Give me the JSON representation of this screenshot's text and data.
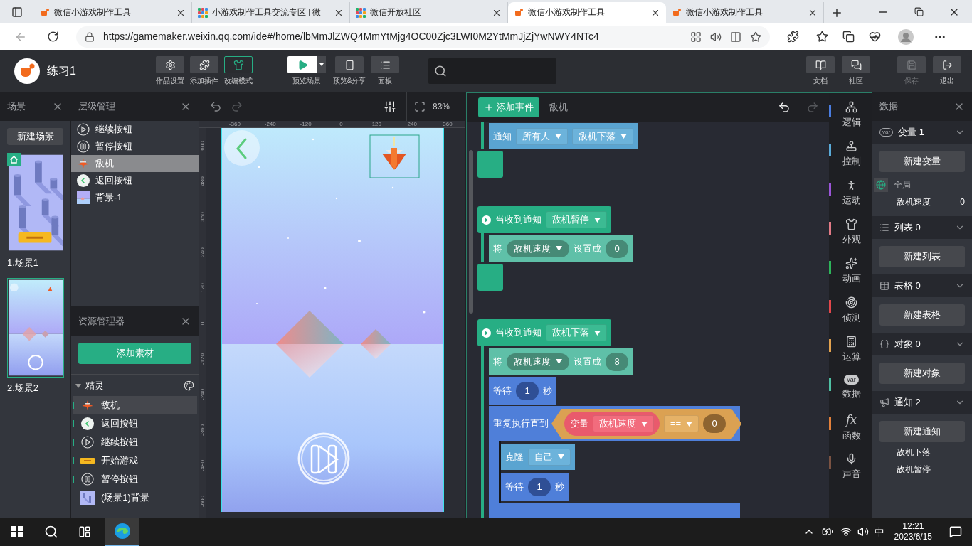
{
  "browser": {
    "tabs": [
      {
        "title": "微信小游戏制作工具",
        "kind": "app",
        "selected": false
      },
      {
        "title": "小游戏制作工具交流专区 | 微",
        "kind": "community",
        "selected": false
      },
      {
        "title": "微信开放社区",
        "kind": "community",
        "selected": false
      },
      {
        "title": "微信小游戏制作工具",
        "kind": "app",
        "selected": true
      },
      {
        "title": "微信小游戏制作工具",
        "kind": "app",
        "selected": false
      }
    ],
    "url": "https://gamemaker.weixin.qq.com/ide#/home/lbMmJlZWQ4MmYtMjg4OC00Zjc3LWI0M2YtMmJjZjYwNWY4NTc4"
  },
  "app_bar": {
    "project": "练习1",
    "tools": [
      {
        "label": "作品设置",
        "kind": "settings",
        "selected": false
      },
      {
        "label": "添加插件",
        "kind": "plugin",
        "selected": false
      },
      {
        "label": "改编模式",
        "kind": "shirt",
        "selected": true
      }
    ],
    "preview": {
      "label": "预览场景"
    },
    "actions": [
      {
        "label": "预览&分享",
        "kind": "phone"
      },
      {
        "label": "面板",
        "kind": "list"
      }
    ],
    "right": [
      {
        "label": "文档",
        "kind": "book",
        "disabled": false
      },
      {
        "label": "社区",
        "kind": "chat",
        "disabled": false
      },
      {
        "label": "保存",
        "kind": "save",
        "disabled": true
      },
      {
        "label": "退出",
        "kind": "exit",
        "disabled": false
      }
    ]
  },
  "scenes": {
    "title": "场景",
    "button": "新建场景",
    "items": [
      {
        "label": "1.场景1",
        "kind": "start",
        "home": true,
        "selected": false
      },
      {
        "label": "2.场景2",
        "kind": "game",
        "home": false,
        "selected": true
      }
    ]
  },
  "layers": {
    "title": "层级管理",
    "items": [
      {
        "name": "继续按钮",
        "kind": "play",
        "selected": false
      },
      {
        "name": "暂停按钮",
        "kind": "pause",
        "selected": false
      },
      {
        "name": "敌机",
        "kind": "plane",
        "selected": true
      },
      {
        "name": "返回按钮",
        "kind": "back",
        "selected": false
      },
      {
        "name": "背景-1",
        "kind": "bg2",
        "selected": false
      }
    ]
  },
  "assets": {
    "title": "资源管理器",
    "button": "添加素材",
    "group": {
      "label": "精灵",
      "expanded": true
    },
    "items": [
      {
        "name": "敌机",
        "kind": "plane",
        "used": true,
        "selected": true
      },
      {
        "name": "返回按钮",
        "kind": "back",
        "used": true,
        "selected": false
      },
      {
        "name": "继续按钮",
        "kind": "play",
        "used": true,
        "selected": false
      },
      {
        "name": "开始游戏",
        "kind": "start",
        "used": true,
        "selected": false
      },
      {
        "name": "暂停按钮",
        "kind": "pause",
        "used": true,
        "selected": false
      },
      {
        "name": "(场景1)背景",
        "kind": "bg1",
        "used": false,
        "selected": false
      }
    ]
  },
  "canvas": {
    "zoom": "83%",
    "x_ticks": [
      "-360",
      "-240",
      "-120",
      "0",
      "120",
      "240",
      "360"
    ],
    "y_ticks": [
      "600",
      "480",
      "360",
      "240",
      "120",
      "0",
      "-120",
      "-240",
      "-360",
      "-480",
      "-600"
    ]
  },
  "code": {
    "button": "添加事件",
    "sprite": "敌机",
    "scripts": [
      {
        "kind": "fragment",
        "end_cap": true,
        "body": [
          {
            "kind": "notify",
            "label": "通知",
            "target": "所有人",
            "message": "敌机下落"
          }
        ]
      },
      {
        "kind": "event",
        "label": "当收到通知",
        "message": "敌机暂停",
        "end_cap": true,
        "body": [
          {
            "kind": "set",
            "label": "将",
            "variable": "敌机速度",
            "to": "设置成",
            "value": "0"
          }
        ]
      },
      {
        "kind": "event",
        "label": "当收到通知",
        "message": "敌机下落",
        "end_cap": false,
        "body": [
          {
            "kind": "set",
            "label": "将",
            "variable": "敌机速度",
            "to": "设置成",
            "value": "8"
          },
          {
            "kind": "wait",
            "label": "等待",
            "value": "1",
            "unit": "秒"
          },
          {
            "kind": "repeat",
            "label": "重复执行直到",
            "condition": {
              "label": "变量",
              "variable": "敌机速度",
              "op": "==",
              "value": "0"
            },
            "body": [
              {
                "kind": "clone",
                "label": "克隆",
                "target": "自己"
              },
              {
                "kind": "wait",
                "label": "等待",
                "value": "1",
                "unit": "秒"
              }
            ]
          }
        ]
      }
    ]
  },
  "categories": [
    {
      "label": "逻辑",
      "kind": "logic",
      "color": "#4a7de0"
    },
    {
      "label": "控制",
      "kind": "control",
      "color": "#5aaad8"
    },
    {
      "label": "运动",
      "kind": "motion",
      "color": "#9b55d8"
    },
    {
      "label": "外观",
      "kind": "looks",
      "color": "#e27a86"
    },
    {
      "label": "动画",
      "kind": "anim",
      "color": "#2db45a"
    },
    {
      "label": "侦测",
      "kind": "sense",
      "color": "#e2474b"
    },
    {
      "label": "运算",
      "kind": "math",
      "color": "#e2a24f"
    },
    {
      "label": "数据",
      "kind": "data",
      "glyph": "var",
      "color": "#4fc0a3"
    },
    {
      "label": "函数",
      "kind": "func",
      "glyph": "fx",
      "color": "#e2803a"
    },
    {
      "label": "声音",
      "kind": "sound",
      "color": "#7a5242"
    }
  ],
  "data": {
    "title": "数据",
    "sections": [
      {
        "kind": "variable",
        "glyph": "var",
        "title": "变量 1",
        "expanded": true,
        "button": "新建变量",
        "scope": "全局",
        "items": [
          {
            "name": "敌机速度",
            "value": "0"
          }
        ]
      },
      {
        "kind": "list",
        "title": "列表 0",
        "expanded": true,
        "button": "新建列表"
      },
      {
        "kind": "table",
        "title": "表格 0",
        "expanded": true,
        "button": "新建表格"
      },
      {
        "kind": "object",
        "title": "对象 0",
        "expanded": true,
        "button": "新建对象"
      },
      {
        "kind": "notice",
        "title": "通知 2",
        "expanded": true,
        "button": "新建通知",
        "items": [
          {
            "name": "敌机下落"
          },
          {
            "name": "敌机暂停"
          }
        ]
      }
    ]
  },
  "taskbar": {
    "ime": "中",
    "time": "12:21",
    "date": "2023/6/15"
  }
}
